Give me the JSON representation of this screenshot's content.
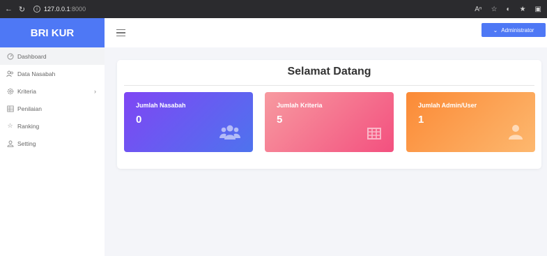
{
  "browser": {
    "url_host": "127.0.0.1",
    "url_port": ":8000"
  },
  "sidebar": {
    "brand": "BRI KUR",
    "items": [
      {
        "label": "Dashboard",
        "icon": "gauge-icon"
      },
      {
        "label": "Data Nasabah",
        "icon": "users-icon"
      },
      {
        "label": "Kriteria",
        "icon": "gear-icon"
      },
      {
        "label": "Penilaian",
        "icon": "table-icon"
      },
      {
        "label": "Ranking",
        "icon": "star-icon"
      },
      {
        "label": "Setting",
        "icon": "user-icon"
      }
    ]
  },
  "topbar": {
    "admin_label": "Administrator"
  },
  "main": {
    "title": "Selamat Datang",
    "stats": [
      {
        "label": "Jumlah Nasabah",
        "value": "0",
        "icon": "users-icon"
      },
      {
        "label": "Jumlah Kriteria",
        "value": "5",
        "icon": "table-icon"
      },
      {
        "label": "Jumlah Admin/User",
        "value": "1",
        "icon": "user-icon"
      }
    ]
  },
  "colors": {
    "brand": "#4e78f5",
    "stat1": "#6a5cf2",
    "stat2": "#f3507f",
    "stat3": "#fb8a36"
  }
}
